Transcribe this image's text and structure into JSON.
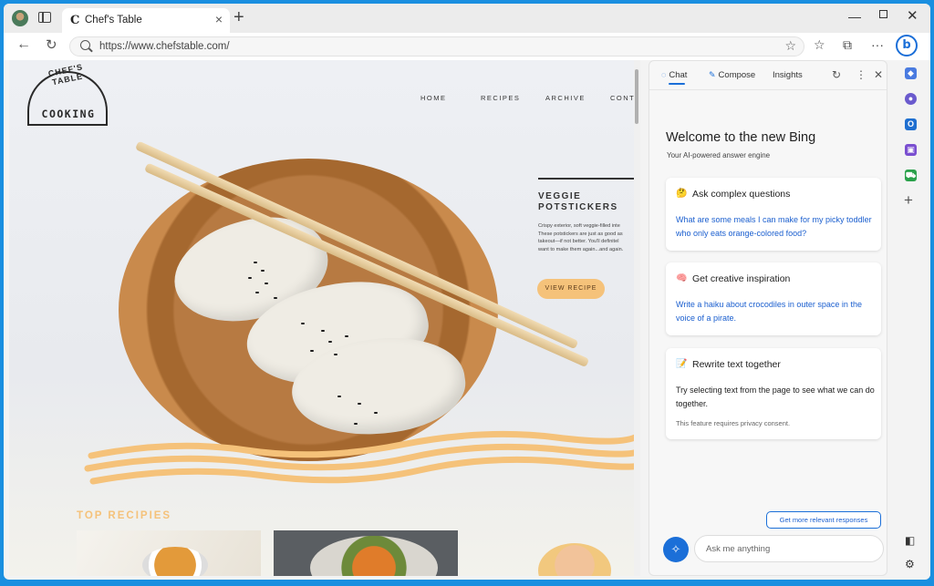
{
  "browser": {
    "tab_title": "Chef's Table",
    "tab_favicon": "C",
    "url": "https://www.chefstable.com/",
    "accent": "#1b6fd8"
  },
  "site": {
    "logo_top": "CHEF'S TABLE",
    "logo_bottom": "COOKING",
    "nav": [
      "HOME",
      "RECIPES",
      "ARCHIVE",
      "CONTACT"
    ],
    "feature_title_1": "VEGGIE",
    "feature_title_2": "POTSTICKERS",
    "feature_desc": [
      "Crispy exterior, soft veggie-filled inte",
      "These potstickers are just as good as",
      "takeout—if not better. You'll definitel",
      "want to make them again...and again."
    ],
    "view_recipe": "VIEW RECIPE",
    "top_recipes": "TOP RECIPIES"
  },
  "panel": {
    "tabs": [
      "Chat",
      "Compose",
      "Insights"
    ],
    "welcome": "Welcome to the new Bing",
    "tagline": "Your AI-powered answer engine",
    "cards": [
      {
        "heading": "Ask complex questions",
        "text": "What are some meals I can make for my picky toddler who only eats orange-colored food?"
      },
      {
        "heading": "Get creative inspiration",
        "text": "Write a haiku about crocodiles in outer space in the voice of a pirate."
      },
      {
        "heading": "Rewrite text together",
        "text": "Try selecting text from the page to see what we can do together.",
        "note": "This feature requires privacy consent."
      }
    ],
    "more_button": "Get more relevant responses",
    "ask_placeholder": "Ask me anything"
  }
}
